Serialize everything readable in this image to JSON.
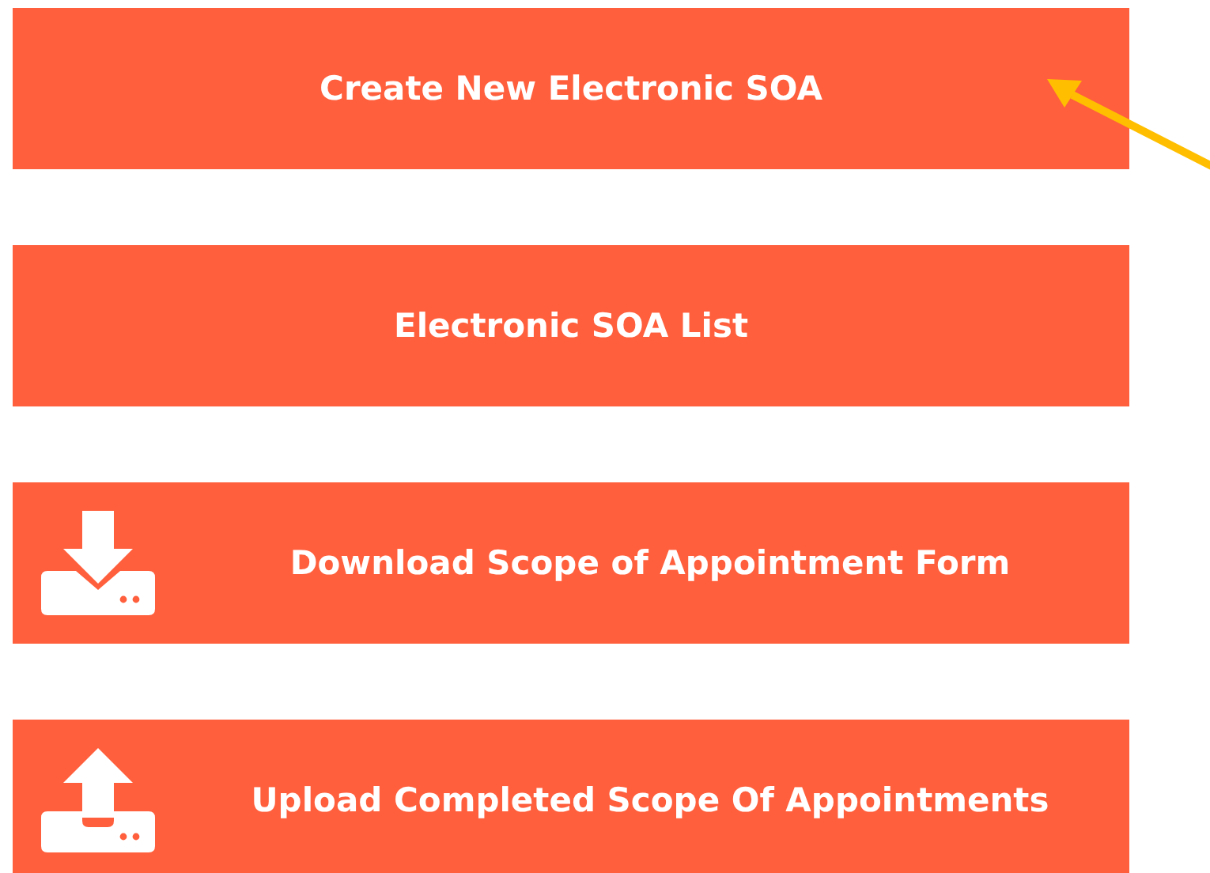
{
  "buttons": [
    {
      "label": "Create New Electronic SOA",
      "kind": "plain"
    },
    {
      "label": "Electronic SOA List",
      "kind": "plain"
    },
    {
      "label": "Download Scope of Appointment Form",
      "kind": "download"
    },
    {
      "label": "Upload Completed Scope Of Appointments",
      "kind": "upload"
    }
  ]
}
